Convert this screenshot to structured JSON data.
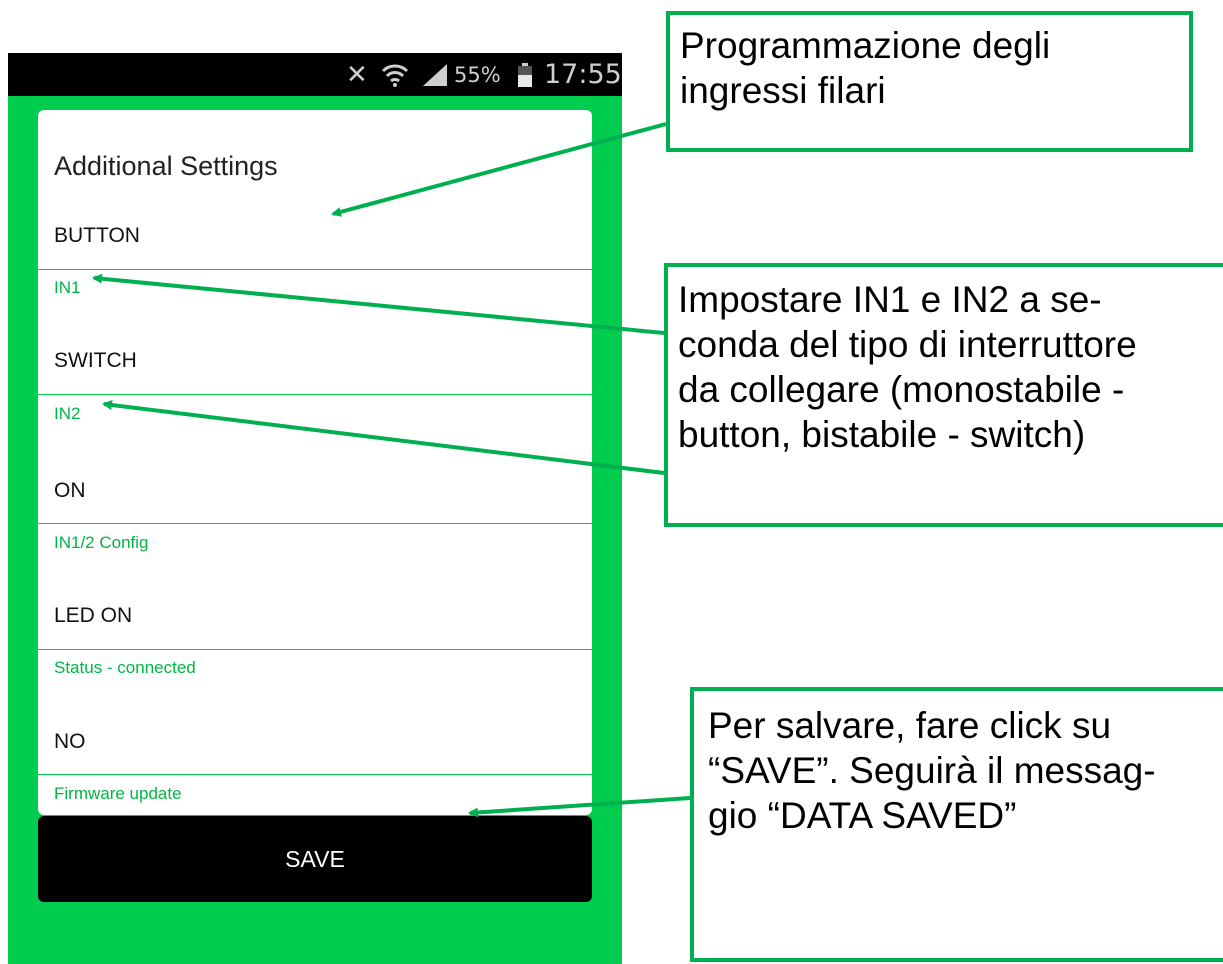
{
  "status_bar": {
    "battery": "55%",
    "time": "17:55",
    "icons": [
      "mute-icon",
      "wifi-icon",
      "signal-icon",
      "battery-icon"
    ]
  },
  "card": {
    "title": "Additional Settings",
    "rows": [
      {
        "value": "BUTTON",
        "label": "IN1"
      },
      {
        "value": "SWITCH",
        "label": "IN2"
      },
      {
        "value": "ON",
        "label": "IN1/2 Config"
      },
      {
        "value": "LED ON",
        "label": "Status - connected"
      },
      {
        "value": "NO",
        "label": "Firmware update"
      }
    ]
  },
  "save_button": {
    "label": "SAVE"
  },
  "callouts": [
    {
      "line1": "Programmazione degli",
      "line2": "ingressi filari"
    },
    {
      "line1": "Impostare IN1 e IN2 a se-",
      "line2": "conda del tipo di interruttore",
      "line3": "da collegare (monostabile -",
      "line4": "button, bistabile - switch)"
    },
    {
      "line1": "Per salvare, fare click su",
      "line2": "“SAVE”. Seguirà il messag-",
      "line3": "gio “DATA SAVED”"
    }
  ],
  "colors": {
    "accent": "#00cc4d",
    "callout_border": "#00b050",
    "arrow": "#00b050"
  }
}
